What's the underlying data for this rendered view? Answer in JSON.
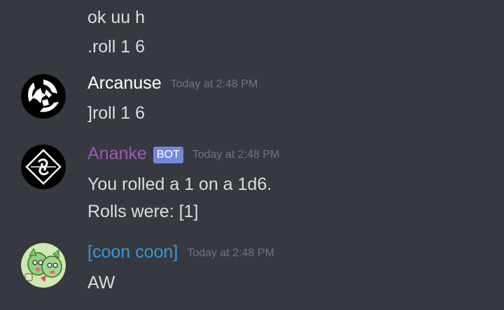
{
  "messages_top": [
    {
      "text": "ok uu h"
    },
    {
      "text": ".roll 1 6"
    }
  ],
  "arcanuse": {
    "username": "Arcanuse",
    "username_color": "#ffffff",
    "timestamp": "Today at 2:48 PM",
    "lines": [
      "]roll 1 6"
    ],
    "avatar_icon": "tri-swirl-icon"
  },
  "ananke": {
    "username": "Ananke",
    "username_color": "#9b59b6",
    "bot_tag": "BOT",
    "timestamp": "Today at 2:48 PM",
    "lines": [
      "You rolled a 1 on a 1d6.",
      "Rolls were: [1]"
    ],
    "avatar_icon": "diamond-swirl-icon"
  },
  "coon": {
    "username": "[coon coon]",
    "username_color": "#3498db",
    "timestamp": "Today at 2:48 PM",
    "lines": [
      "AW"
    ],
    "avatar_icon": "green-creature-icon"
  },
  "colors": {
    "background": "#36393f",
    "text": "#dcddde",
    "timestamp": "#72767d",
    "bot_tag_bg": "#7289da"
  }
}
